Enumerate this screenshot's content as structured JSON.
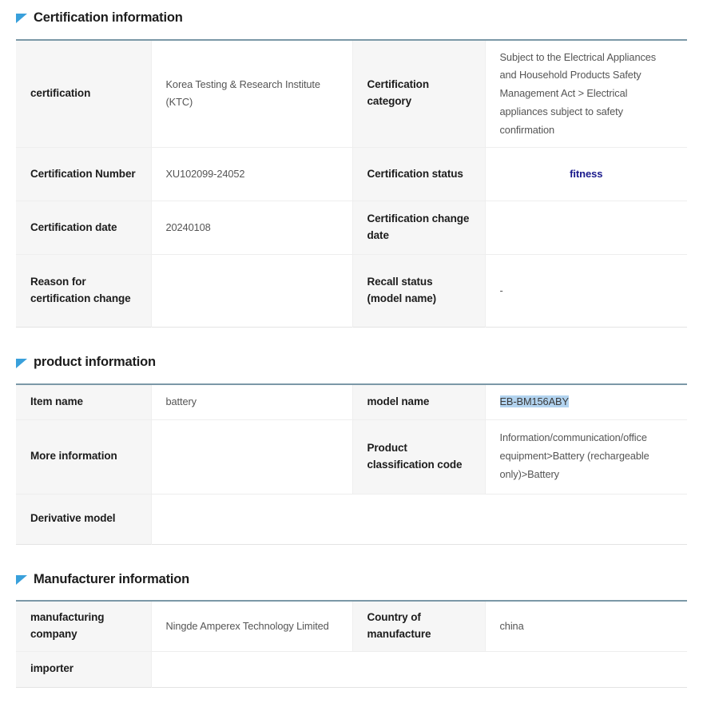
{
  "theme": {
    "accent_line": "#7b98a7",
    "flag_icon_color": "#39a0db",
    "status_color": "#1a1a8c",
    "selection_highlight": "#b2d3ef",
    "label_cell_bg": "#f6f6f6"
  },
  "sections": [
    {
      "id": "certification-information",
      "title": "Certification information",
      "icon": "flag-triangle-icon",
      "rows": [
        {
          "label_1": "certification",
          "value_1": "Korea Testing & Research Institute (KTC)",
          "label_2": "Certification category",
          "value_2": "Subject to the Electrical Appliances and Household Products Safety Management Act > Electrical appliances subject to safety confirmation"
        },
        {
          "label_1": "Certification Number",
          "value_1": "XU102099-24052",
          "label_2": "Certification status",
          "value_2": "fitness"
        },
        {
          "label_1": "Certification date",
          "value_1": "20240108",
          "label_2": "Certification change date",
          "value_2": ""
        },
        {
          "label_1": "Reason for certification change",
          "value_1": "",
          "label_2": "Recall status (model name)",
          "value_2": "-"
        }
      ]
    },
    {
      "id": "product-information",
      "title": "product information",
      "icon": "flag-triangle-icon",
      "rows": [
        {
          "label_1": "Item name",
          "value_1": "battery",
          "label_2": "model name",
          "value_2": "EB-BM156ABY"
        },
        {
          "label_1": "More information",
          "value_1": "",
          "label_2": "Product classification code",
          "value_2": "Information/communication/office equipment>Battery (rechargeable only)>Battery"
        },
        {
          "label_1": "Derivative model",
          "value_1": ""
        }
      ]
    },
    {
      "id": "manufacturer-information",
      "title": "Manufacturer information",
      "icon": "flag-triangle-icon",
      "rows": [
        {
          "label_1": "manufacturing company",
          "value_1": "Ningde Amperex Technology Limited",
          "label_2": "Country of manufacture",
          "value_2": "china"
        },
        {
          "label_1": "importer",
          "value_1": ""
        }
      ]
    }
  ]
}
